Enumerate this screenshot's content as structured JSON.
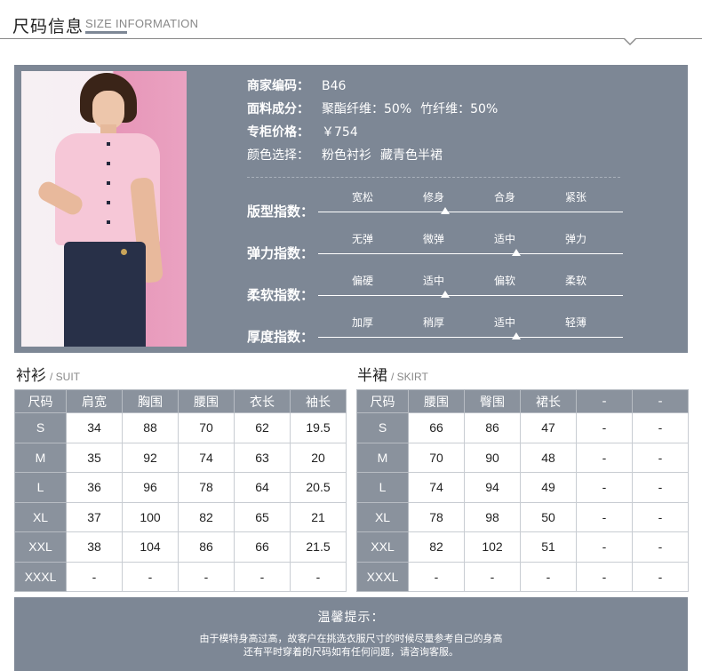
{
  "header": {
    "title": "尺码信息",
    "subtitle": "SIZE INFORMATION"
  },
  "product": {
    "fields": [
      {
        "label": "商家编码：",
        "values": [
          "B46"
        ],
        "bold": true
      },
      {
        "label": "面料成分：",
        "values": [
          "聚酯纤维：50%",
          "竹纤维：50%"
        ],
        "bold": true
      },
      {
        "label": "专柜价格：",
        "values": [
          "￥754"
        ],
        "bold": true
      },
      {
        "label": "颜色选择：",
        "values": [
          "粉色衬衫",
          "藏青色半裙"
        ],
        "bold": false
      }
    ]
  },
  "indices": [
    {
      "label": "版型指数：",
      "options": [
        "宽松",
        "修身",
        "合身",
        "紧张"
      ],
      "selected_index": 1
    },
    {
      "label": "弹力指数：",
      "options": [
        "无弹",
        "微弹",
        "适中",
        "弹力"
      ],
      "selected_index": 2
    },
    {
      "label": "柔软指数：",
      "options": [
        "偏硬",
        "适中",
        "偏软",
        "柔软"
      ],
      "selected_index": 1
    },
    {
      "label": "厚度指数：",
      "options": [
        "加厚",
        "稍厚",
        "适中",
        "轻薄"
      ],
      "selected_index": 2
    }
  ],
  "shirt_table": {
    "title": "衬衫",
    "subtitle": "/ SUIT",
    "headers": [
      "尺码",
      "肩宽",
      "胸围",
      "腰围",
      "衣长",
      "袖长"
    ],
    "rows": [
      [
        "S",
        "34",
        "88",
        "70",
        "62",
        "19.5"
      ],
      [
        "M",
        "35",
        "92",
        "74",
        "63",
        "20"
      ],
      [
        "L",
        "36",
        "96",
        "78",
        "64",
        "20.5"
      ],
      [
        "XL",
        "37",
        "100",
        "82",
        "65",
        "21"
      ],
      [
        "XXL",
        "38",
        "104",
        "86",
        "66",
        "21.5"
      ],
      [
        "XXXL",
        "-",
        "-",
        "-",
        "-",
        "-"
      ]
    ]
  },
  "skirt_table": {
    "title": "半裙",
    "subtitle": "/ SKIRT",
    "headers": [
      "尺码",
      "腰围",
      "臀围",
      "裙长",
      "-",
      "-"
    ],
    "rows": [
      [
        "S",
        "66",
        "86",
        "47",
        "-",
        "-"
      ],
      [
        "M",
        "70",
        "90",
        "48",
        "-",
        "-"
      ],
      [
        "L",
        "74",
        "94",
        "49",
        "-",
        "-"
      ],
      [
        "XL",
        "78",
        "98",
        "50",
        "-",
        "-"
      ],
      [
        "XXL",
        "82",
        "102",
        "51",
        "-",
        "-"
      ],
      [
        "XXXL",
        "-",
        "-",
        "-",
        "-",
        "-"
      ]
    ]
  },
  "notice": {
    "title": "温馨提示：",
    "lines": [
      "由于模特身高过高，故客户在挑选衣服尺寸的时候尽量参考自己的身高",
      "还有平时穿着的尺码如有任何问题，请咨询客服。"
    ]
  },
  "colors": {
    "panel": "#7d8795",
    "header_cell": "#8a929d"
  }
}
